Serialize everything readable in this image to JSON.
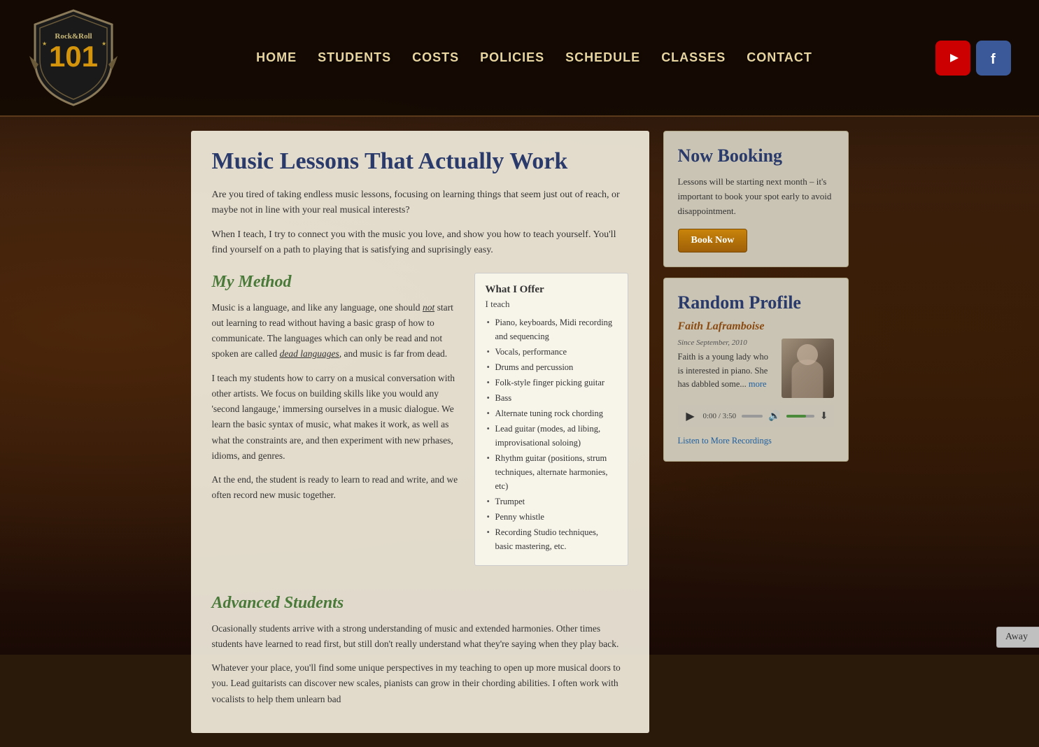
{
  "site": {
    "title": "Rock & Roll 101"
  },
  "header": {
    "nav_items": [
      {
        "label": "HOME",
        "href": "#home"
      },
      {
        "label": "STUDENTS",
        "href": "#students"
      },
      {
        "label": "COSTS",
        "href": "#costs"
      },
      {
        "label": "POLICIES",
        "href": "#policies"
      },
      {
        "label": "SCHEDULE",
        "href": "#schedule"
      },
      {
        "label": "CLASSES",
        "href": "#classes"
      },
      {
        "label": "CONTACT",
        "href": "#contact"
      }
    ],
    "social": {
      "youtube_label": "You Tube",
      "facebook_label": "f"
    }
  },
  "main": {
    "page_title": "Music Lessons That Actually Work",
    "intro_p1": "Are you tired of taking endless music lessons, focusing on learning things that seem just out of reach, or maybe not in line with your real musical interests?",
    "intro_p2": "When I teach, I try to connect you with the music you love, and show you how to teach yourself. You'll find yourself on a path to playing that is satisfying and suprisingly easy.",
    "my_method": {
      "heading": "My Method",
      "p1": "Music is a language, and like any language, one should not start out learning to read without having a basic grasp of how to communicate. The languages which can only be read and not spoken are called dead languages, and music is far from dead.",
      "p2": "I teach my students how to carry on a musical conversation with other artists. We focus on building skills like you would any 'second langauge,' immersing ourselves in a music dialogue. We learn the basic syntax of music, what makes it work, as well as what the constraints are, and then experiment with new prhases, idioms, and genres.",
      "p3": "At the end, the student is ready to learn to read and write, and we often record new music together."
    },
    "what_i_offer": {
      "title": "What I Offer",
      "subtitle": "I teach",
      "items": [
        "Piano, keyboards, Midi recording and sequencing",
        "Vocals, performance",
        "Drums and percussion",
        "Folk-style finger picking guitar",
        "Bass",
        "Alternate tuning rock chording",
        "Lead guitar (modes, ad libing, improvisational soloing)",
        "Rhythm guitar (positions, strum techniques, alternate harmonies, etc)",
        "Trumpet",
        "Penny whistle",
        "Recording Studio techniques, basic mastering, etc."
      ]
    },
    "advanced": {
      "heading": "Advanced Students",
      "p1": "Ocasionally students arrive with a strong understanding of music and extended harmonies. Other times students have learned to read first, but still don't really understand what they're saying when they play back.",
      "p2": "Whatever your place, you'll find some unique perspectives in my teaching to open up more musical doors to you. Lead guitarists can discover new scales, pianists can grow in their chording abilities. I often work with vocalists to help them unlearn bad"
    }
  },
  "sidebar": {
    "booking": {
      "title": "Now Booking",
      "text": "Lessons will be starting next month – it's important to book your spot early to avoid disappointment.",
      "button_label": "Book Now"
    },
    "profile": {
      "title": "Random Profile",
      "name": "Faith Laframboise",
      "since": "Since September, 2010",
      "bio": "Faith is a young lady who is interested in piano. She has dabbled some...",
      "more_label": "more",
      "audio": {
        "time_current": "0:00",
        "time_total": "3:50"
      },
      "recordings_link": "Listen to More Recordings"
    }
  },
  "away_badge": {
    "label": "Away"
  }
}
